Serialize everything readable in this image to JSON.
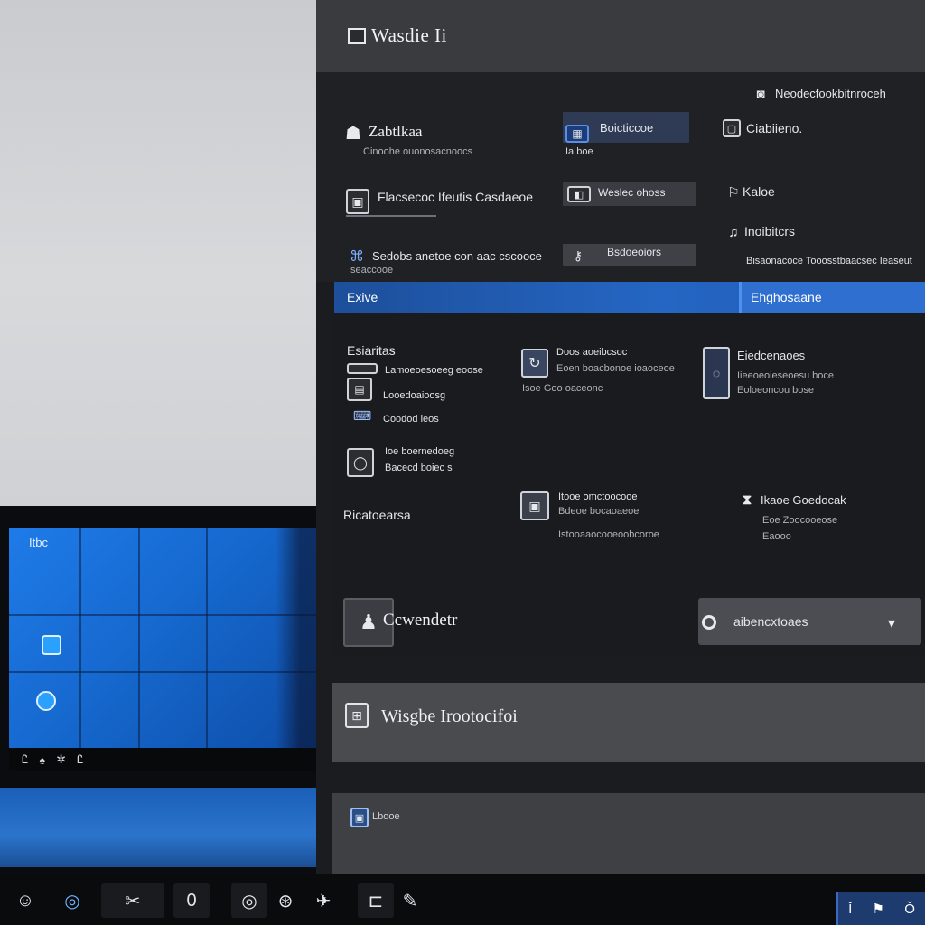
{
  "window": {
    "title": "Wasdie Ii"
  },
  "top_right_link": {
    "label": "Neodecfookbitnroceh"
  },
  "top_items": [
    {
      "title": "Zabtlkaa",
      "subtitle": "Cinoohe ouonosacnoocs"
    },
    {
      "title": "Flacsecoc Ifeutis Casdaeoe",
      "subtitle": ""
    },
    {
      "title": "Sedobs anetoe con aac cscooce",
      "subtitle": "seaccooe"
    }
  ],
  "mid_chips": [
    {
      "title": "Boicticcoe",
      "subtitle": "Ia boe"
    },
    {
      "title": "Weslec ohoss",
      "subtitle": ""
    },
    {
      "title": "Bsdoeoiors",
      "subtitle": ""
    }
  ],
  "right_items": [
    {
      "title": "Ciabiieno."
    },
    {
      "title": "Kaloe"
    },
    {
      "title": "Inoibitcrs",
      "subtitle": "Bisaonacoce Tooosstbaacsec Ieaseut"
    }
  ],
  "blue_bar": {
    "left_label": "Exive",
    "right_label": "Ehghosaane"
  },
  "sections": {
    "left_heading": "Esiaritas",
    "left_items": [
      {
        "label": "Lamoeoesoeeg eoose"
      },
      {
        "label": "Looedoaioosg"
      },
      {
        "label": "Coodod ieos"
      },
      {
        "label": "Ioe boernedoeg",
        "sub": "Bacecd boiec s"
      }
    ],
    "center_items": [
      {
        "title": "Doos aoeibcsoc",
        "lines": [
          "Eoen boacbonoe ioaoceoe",
          "Isoe Goo oaceonc"
        ]
      },
      {
        "title": "Itooe omctoocooe",
        "lines": [
          "Bdeoe bocaoaeoe",
          "Istooaaocooeoobcoroe"
        ]
      }
    ],
    "right_items": [
      {
        "title": "Eiedcenaoes",
        "lines": [
          "Iieeoeoieseoesu boce",
          "Eoloeoncou bose"
        ]
      },
      {
        "title": "Ikaoe Goedocak",
        "lines": [
          "Eoe Zoocooeose",
          "Eaooo"
        ]
      }
    ],
    "second_heading": "Ricatoearsa"
  },
  "control": {
    "label": "Ccwendetr",
    "dropdown_value": "aibencxtoaes",
    "chevron": "▾"
  },
  "card_1": {
    "label": "Wisgbe Irootocifoi"
  },
  "card_2": {
    "label": "Lbooe"
  },
  "desktop": {
    "labels": [
      "Itbc"
    ],
    "taskbar_glyphs": [
      "Ꮭ",
      "♠",
      "✲",
      "Ꮭ"
    ]
  },
  "taskbar": {
    "buttons": [
      "☺",
      "◎",
      "✂",
      "0",
      "◎",
      "⊛",
      "✈",
      "⊏",
      "✎"
    ],
    "tray": [
      "Ǐ",
      "⚑",
      "Ǒ"
    ]
  },
  "colors": {
    "accent_blue": "#2566c4",
    "panel_bg": "#1b1c1f",
    "header_bg": "#3a3b3e"
  }
}
